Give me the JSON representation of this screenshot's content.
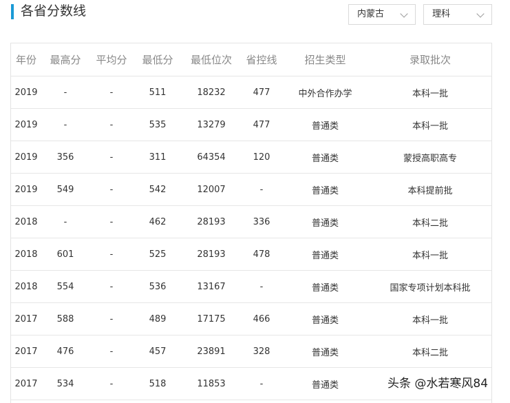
{
  "page": {
    "title": "各省分数线"
  },
  "filters": {
    "province": "内蒙古",
    "subject": "理科"
  },
  "table": {
    "headers": [
      "年份",
      "最高分",
      "平均分",
      "最低分",
      "最低位次",
      "省控线",
      "招生类型",
      "录取批次"
    ],
    "rows": [
      [
        "2019",
        "-",
        "-",
        "511",
        "18232",
        "477",
        "中外合作办学",
        "本科一批"
      ],
      [
        "2019",
        "-",
        "-",
        "535",
        "13279",
        "477",
        "普通类",
        "本科一批"
      ],
      [
        "2019",
        "356",
        "-",
        "311",
        "64354",
        "120",
        "普通类",
        "蒙授高职高专"
      ],
      [
        "2019",
        "549",
        "-",
        "542",
        "12007",
        "-",
        "普通类",
        "本科提前批"
      ],
      [
        "2018",
        "-",
        "-",
        "462",
        "28193",
        "336",
        "普通类",
        "本科二批"
      ],
      [
        "2018",
        "601",
        "-",
        "525",
        "28193",
        "478",
        "普通类",
        "本科一批"
      ],
      [
        "2018",
        "554",
        "-",
        "536",
        "13167",
        "-",
        "普通类",
        "国家专项计划本科批"
      ],
      [
        "2017",
        "588",
        "-",
        "489",
        "17175",
        "466",
        "普通类",
        "本科一批"
      ],
      [
        "2017",
        "476",
        "-",
        "457",
        "23891",
        "328",
        "普通类",
        "本科二批"
      ],
      [
        "2017",
        "534",
        "-",
        "518",
        "11853",
        "-",
        "普通类",
        ""
      ]
    ]
  },
  "watermark": "头条 @水若寒风84"
}
